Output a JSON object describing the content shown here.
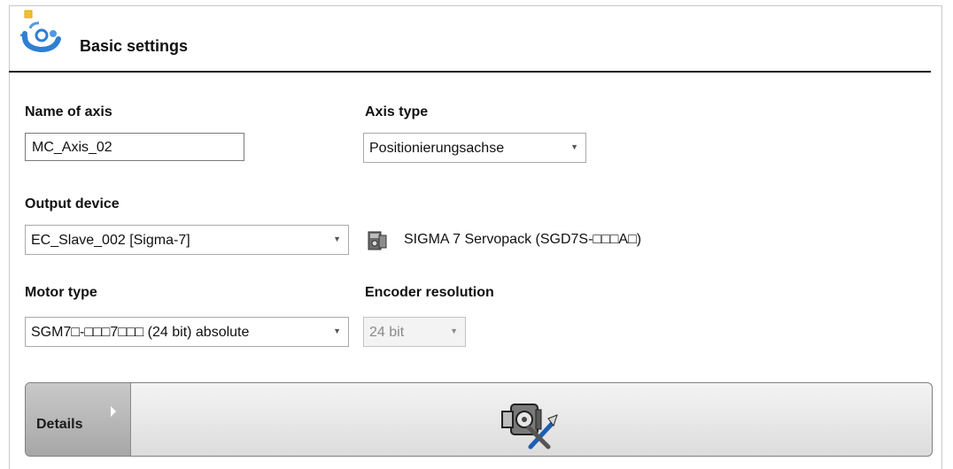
{
  "header": {
    "title": "Basic settings",
    "icon": "settings-cycle-icon"
  },
  "axis_name": {
    "label": "Name of axis",
    "value": "MC_Axis_02"
  },
  "axis_type": {
    "label": "Axis type",
    "selected": "Positionierungsachse"
  },
  "output_device": {
    "label": "Output device",
    "selected": "EC_Slave_002 [Sigma-7]",
    "device_description": "SIGMA 7 Servopack (SGD7S-□□□A□)",
    "icon": "servopack-icon"
  },
  "motor_type": {
    "label": "Motor type",
    "selected": "SGM7□-□□□7□□□ (24 bit) absolute"
  },
  "encoder_resolution": {
    "label": "Encoder resolution",
    "selected": "24 bit"
  },
  "details": {
    "label": "Details",
    "icon": "servo-motor-tools-icon"
  },
  "colors": {
    "rule": "#1c1c1c",
    "details_tab": "#b8b8b8",
    "details_bar": "#e6e6e6"
  }
}
